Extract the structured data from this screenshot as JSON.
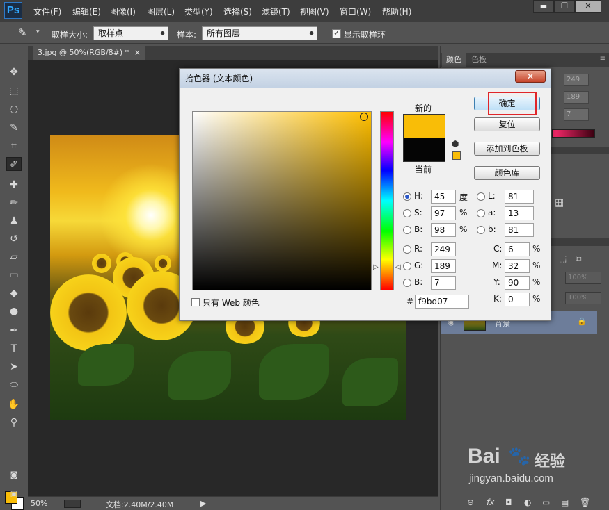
{
  "menubar": {
    "logo": "Ps",
    "items": [
      "文件(F)",
      "编辑(E)",
      "图像(I)",
      "图层(L)",
      "类型(Y)",
      "选择(S)",
      "滤镜(T)",
      "视图(V)",
      "窗口(W)",
      "帮助(H)"
    ],
    "window_buttons": [
      "▬",
      "❐",
      "✕"
    ]
  },
  "options": {
    "tool_glyph": "✎",
    "sample_size_label": "取样大小:",
    "sample_size_value": "取样点",
    "sample_label": "样本:",
    "sample_value": "所有图层",
    "show_ring_label": "显示取样环",
    "show_ring_checked": "✓"
  },
  "document": {
    "tab_title": "3.jpg @ 50%(RGB/8#) *",
    "tab_close": "×"
  },
  "status": {
    "zoom": "50%",
    "doc_info": "文档:2.40M/2.40M",
    "arrow": "▶"
  },
  "right_panel": {
    "tabs": [
      "颜色",
      "色板"
    ],
    "values": [
      "249",
      "189",
      "7"
    ],
    "layer_name": "背景",
    "opacity_placeholder": "100%",
    "fill_placeholder": "100%",
    "bottom_icons": [
      "⊖",
      "fx",
      "◘",
      "◐",
      "▭",
      "▤",
      "🗑"
    ]
  },
  "dialog": {
    "title": "拾色器 (文本颜色)",
    "close": "✕",
    "new_label": "新的",
    "current_label": "当前",
    "buttons": {
      "ok": "确定",
      "reset": "复位",
      "add_swatch": "添加到色板",
      "library": "颜色库"
    },
    "web_only_label": "只有 Web 颜色",
    "hsb": {
      "h_label": "H:",
      "h_value": "45",
      "h_unit": "度",
      "s_label": "S:",
      "s_value": "97",
      "s_unit": "%",
      "b_label": "B:",
      "b_value": "98",
      "b_unit": "%"
    },
    "rgb": {
      "r_label": "R:",
      "r_value": "249",
      "g_label": "G:",
      "g_value": "189",
      "b_label": "B:",
      "b_value": "7"
    },
    "lab": {
      "l_label": "L:",
      "l_value": "81",
      "a_label": "a:",
      "a_value": "13",
      "b_label": "b:",
      "b_value": "81"
    },
    "cmyk": {
      "c_label": "C:",
      "c_value": "6",
      "m_label": "M:",
      "m_value": "32",
      "y_label": "Y:",
      "y_value": "90",
      "k_label": "K:",
      "k_value": "0",
      "unit": "%"
    },
    "hex_label": "#",
    "hex_value": "f9bd07",
    "selected_color": "#f9bd07"
  },
  "watermark": {
    "brand": "Bai",
    "brand_tail": "经验",
    "url": "jingyan.baidu.com"
  }
}
